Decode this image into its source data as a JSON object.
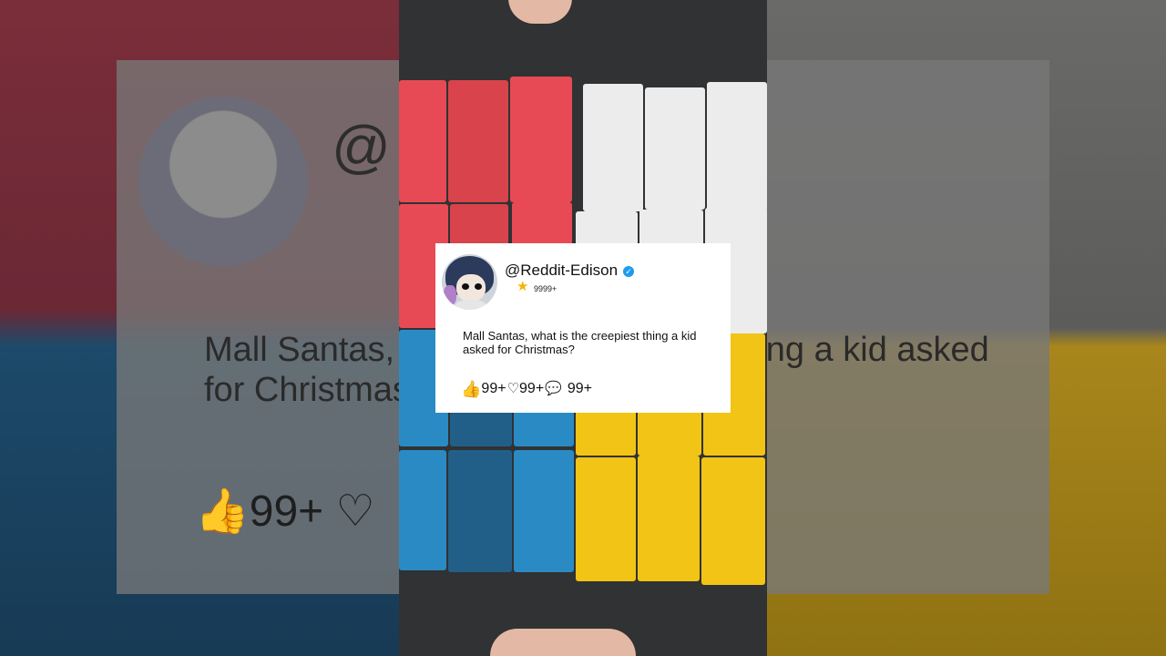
{
  "overlay": {
    "username": "@Reddit-Edison",
    "follower_count": "9999+",
    "post_text": "Mall Santas, what is the creepiest thing a kid asked for Christmas?",
    "likes": "99+",
    "hearts": "99+",
    "comments": "99+"
  },
  "background_card": {
    "at_symbol": "@",
    "text": "Mall Santas, what is the creepiest thing a kid asked for Christmas?",
    "likes": "99+"
  },
  "icons": [
    "thumbs-up-icon",
    "heart-icon",
    "comment-icon",
    "verified-icon",
    "star-icon"
  ],
  "colors": {
    "red_block": "#e84a55",
    "white_block": "#ececec",
    "blue_block": "#2a8bc4",
    "yellow_block": "#f2c415",
    "verified_blue": "#1d9bf0",
    "star_gold": "#f4b400"
  }
}
